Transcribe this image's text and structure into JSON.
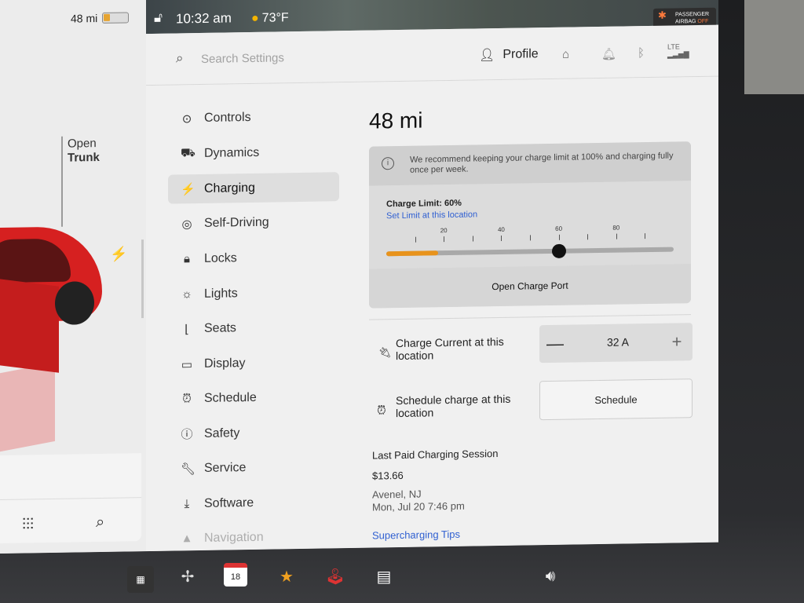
{
  "status": {
    "range": "48 mi",
    "time": "10:32 am",
    "temperature": "73°F",
    "airbag_line1": "PASSENGER",
    "airbag_line2": "AIRBAG",
    "airbag_state": "OFF"
  },
  "car": {
    "trunk_label_1": "Open",
    "trunk_label_2": "Trunk"
  },
  "header": {
    "search_placeholder": "Search Settings",
    "profile_label": "Profile",
    "signal_label": "LTE"
  },
  "nav": {
    "items": [
      {
        "label": "Controls",
        "icon": "toggle-icon"
      },
      {
        "label": "Dynamics",
        "icon": "car-icon"
      },
      {
        "label": "Charging",
        "icon": "bolt-icon",
        "active": true
      },
      {
        "label": "Self-Driving",
        "icon": "steering-wheel-icon"
      },
      {
        "label": "Locks",
        "icon": "lock-icon"
      },
      {
        "label": "Lights",
        "icon": "sun-icon"
      },
      {
        "label": "Seats",
        "icon": "seat-icon"
      },
      {
        "label": "Display",
        "icon": "display-icon"
      },
      {
        "label": "Schedule",
        "icon": "alarm-icon"
      },
      {
        "label": "Safety",
        "icon": "alert-icon"
      },
      {
        "label": "Service",
        "icon": "wrench-icon"
      },
      {
        "label": "Software",
        "icon": "download-icon"
      },
      {
        "label": "Navigation",
        "icon": "navigation-icon"
      }
    ]
  },
  "charging": {
    "range": "48 mi",
    "tip": "We recommend keeping your charge limit at 100% and charging fully once per week.",
    "charge_limit_label": "Charge Limit: 60%",
    "charge_limit_percent": 60,
    "current_charge_percent": 18,
    "set_limit_link": "Set Limit at this location",
    "slider_ticks": [
      "20",
      "40",
      "60",
      "80"
    ],
    "open_port_label": "Open Charge Port",
    "current_label": "Charge Current at this location",
    "current_value": "32  A",
    "minus_label": "—",
    "plus_label": "+",
    "schedule_label": "Schedule charge at this location",
    "schedule_button": "Schedule",
    "last_session_title": "Last Paid Charging Session",
    "last_session_amount": "$13.66",
    "last_session_place": "Avenel, NJ",
    "last_session_date": "Mon, Jul 20 7:46 pm",
    "supercharging_tips": "Supercharging Tips",
    "accent_color": "#e8931c",
    "link_color": "#2f5fd1"
  },
  "taskbar": {
    "calendar_day": "18"
  }
}
